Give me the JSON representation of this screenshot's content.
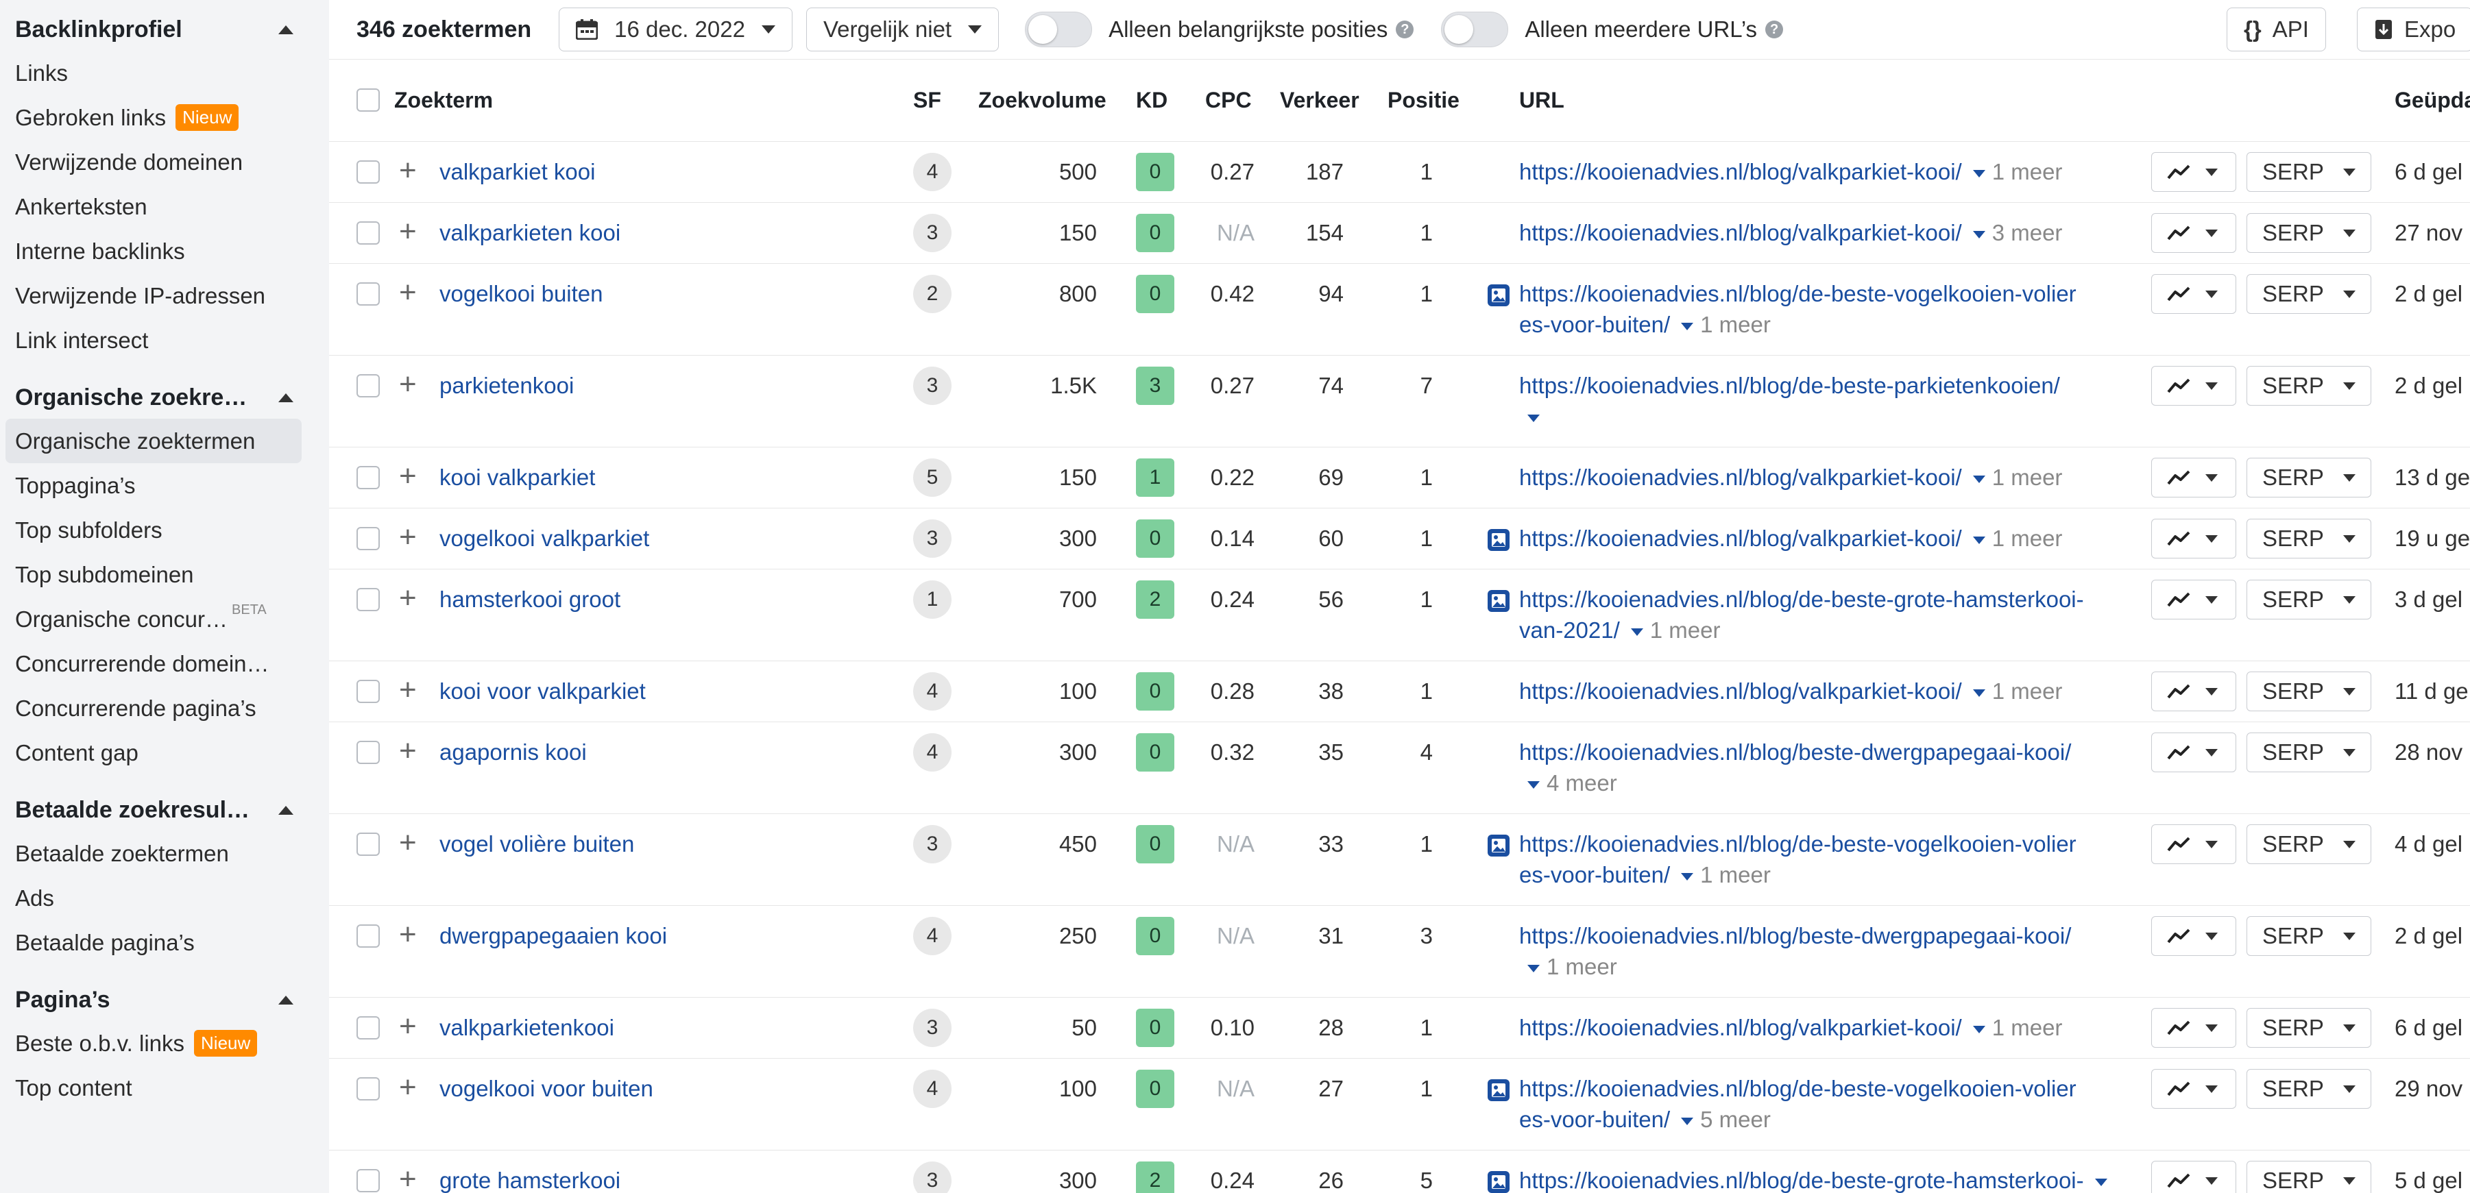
{
  "sidebar": {
    "sections": [
      {
        "title": "Backlinkprofiel",
        "items": [
          {
            "label": "Links"
          },
          {
            "label": "Gebroken links",
            "badge": "Nieuw"
          },
          {
            "label": "Verwijzende domeinen"
          },
          {
            "label": "Ankerteksten"
          },
          {
            "label": "Interne backlinks"
          },
          {
            "label": "Verwijzende IP-adressen"
          },
          {
            "label": "Link intersect"
          }
        ]
      },
      {
        "title": "Organische zoekre…",
        "items": [
          {
            "label": "Organische zoektermen",
            "active": true
          },
          {
            "label": "Toppagina’s"
          },
          {
            "label": "Top subfolders"
          },
          {
            "label": "Top subdomeinen"
          },
          {
            "label": "Organische concur…",
            "beta": "BETA"
          },
          {
            "label": "Concurrerende domein…"
          },
          {
            "label": "Concurrerende pagina’s"
          },
          {
            "label": "Content gap"
          }
        ]
      },
      {
        "title": "Betaalde zoekresul…",
        "items": [
          {
            "label": "Betaalde zoektermen"
          },
          {
            "label": "Ads"
          },
          {
            "label": "Betaalde pagina’s"
          }
        ]
      },
      {
        "title": "Pagina’s",
        "items": [
          {
            "label": "Beste o.b.v. links",
            "badge": "Nieuw"
          },
          {
            "label": "Top content"
          }
        ]
      }
    ]
  },
  "toolbar": {
    "count": "346 zoektermen",
    "date": "16 dec. 2022",
    "compare": "Vergelijk niet",
    "toggle1": "Alleen belangrijkste posities",
    "toggle2": "Alleen meerdere URL’s",
    "api": "API",
    "export": "Expo"
  },
  "table": {
    "headers": {
      "keyword": "Zoekterm",
      "sf": "SF",
      "volume": "Zoekvolume",
      "kd": "KD",
      "cpc": "CPC",
      "traffic": "Verkeer",
      "position": "Positie",
      "url": "URL",
      "updated": "Geüpda"
    },
    "serp_label": "SERP",
    "rows": [
      {
        "keyword": "valkparkiet kooi",
        "sf": "4",
        "volume": "500",
        "kd": "0",
        "cpc": "0.27",
        "traffic": "187",
        "position": "1",
        "url1": "https://kooienadvies.nl/blog/valkparkiet-kooi/",
        "url2": "",
        "more": "1 meer",
        "img": false,
        "updated": "6 d gel",
        "tall": false
      },
      {
        "keyword": "valkparkieten kooi",
        "sf": "3",
        "volume": "150",
        "kd": "0",
        "cpc": "N/A",
        "traffic": "154",
        "position": "1",
        "url1": "https://kooienadvies.nl/blog/valkparkiet-kooi/",
        "url2": "",
        "more": "3 meer",
        "img": false,
        "updated": "27 nov",
        "tall": false
      },
      {
        "keyword": "vogelkooi buiten",
        "sf": "2",
        "volume": "800",
        "kd": "0",
        "cpc": "0.42",
        "traffic": "94",
        "position": "1",
        "url1": "https://kooienadvies.nl/blog/de-beste-vogelkooien-volier",
        "url2": "es-voor-buiten/",
        "more": "1 meer",
        "img": true,
        "updated": "2 d gel",
        "tall": true
      },
      {
        "keyword": "parkietenkooi",
        "sf": "3",
        "volume": "1.5K",
        "kd": "3",
        "cpc": "0.27",
        "traffic": "74",
        "position": "7",
        "url1": "https://kooienadvies.nl/blog/de-beste-parkietenkooien/",
        "url2": "",
        "more": "",
        "img": false,
        "updated": "2 d gel",
        "tall": true
      },
      {
        "keyword": "kooi valkparkiet",
        "sf": "5",
        "volume": "150",
        "kd": "1",
        "cpc": "0.22",
        "traffic": "69",
        "position": "1",
        "url1": "https://kooienadvies.nl/blog/valkparkiet-kooi/",
        "url2": "",
        "more": "1 meer",
        "img": false,
        "updated": "13 d ge",
        "tall": false
      },
      {
        "keyword": "vogelkooi valkparkiet",
        "sf": "3",
        "volume": "300",
        "kd": "0",
        "cpc": "0.14",
        "traffic": "60",
        "position": "1",
        "url1": "https://kooienadvies.nl/blog/valkparkiet-kooi/",
        "url2": "",
        "more": "1 meer",
        "img": true,
        "updated": "19 u ge",
        "tall": false
      },
      {
        "keyword": "hamsterkooi groot",
        "sf": "1",
        "volume": "700",
        "kd": "2",
        "cpc": "0.24",
        "traffic": "56",
        "position": "1",
        "url1": "https://kooienadvies.nl/blog/de-beste-grote-hamsterkooi-",
        "url2": "van-2021/",
        "more": "1 meer",
        "img": true,
        "updated": "3 d gel",
        "tall": true
      },
      {
        "keyword": "kooi voor valkparkiet",
        "sf": "4",
        "volume": "100",
        "kd": "0",
        "cpc": "0.28",
        "traffic": "38",
        "position": "1",
        "url1": "https://kooienadvies.nl/blog/valkparkiet-kooi/",
        "url2": "",
        "more": "1 meer",
        "img": false,
        "updated": "11 d ge",
        "tall": false
      },
      {
        "keyword": "agapornis kooi",
        "sf": "4",
        "volume": "300",
        "kd": "0",
        "cpc": "0.32",
        "traffic": "35",
        "position": "4",
        "url1": "https://kooienadvies.nl/blog/beste-dwergpapegaai-kooi/",
        "url2": "",
        "more": "4 meer",
        "img": false,
        "updated": "28 nov",
        "tall": true
      },
      {
        "keyword": "vogel volière buiten",
        "sf": "3",
        "volume": "450",
        "kd": "0",
        "cpc": "N/A",
        "traffic": "33",
        "position": "1",
        "url1": "https://kooienadvies.nl/blog/de-beste-vogelkooien-volier",
        "url2": "es-voor-buiten/",
        "more": "1 meer",
        "img": true,
        "updated": "4 d gel",
        "tall": true
      },
      {
        "keyword": "dwergpapegaaien kooi",
        "sf": "4",
        "volume": "250",
        "kd": "0",
        "cpc": "N/A",
        "traffic": "31",
        "position": "3",
        "url1": "https://kooienadvies.nl/blog/beste-dwergpapegaai-kooi/",
        "url2": "",
        "more": "1 meer",
        "img": false,
        "updated": "2 d gel",
        "tall": true
      },
      {
        "keyword": "valkparkietenkooi",
        "sf": "3",
        "volume": "50",
        "kd": "0",
        "cpc": "0.10",
        "traffic": "28",
        "position": "1",
        "url1": "https://kooienadvies.nl/blog/valkparkiet-kooi/",
        "url2": "",
        "more": "1 meer",
        "img": false,
        "updated": "6 d gel",
        "tall": false
      },
      {
        "keyword": "vogelkooi voor buiten",
        "sf": "4",
        "volume": "100",
        "kd": "0",
        "cpc": "N/A",
        "traffic": "27",
        "position": "1",
        "url1": "https://kooienadvies.nl/blog/de-beste-vogelkooien-volier",
        "url2": "es-voor-buiten/",
        "more": "5 meer",
        "img": true,
        "updated": "29 nov",
        "tall": true
      },
      {
        "keyword": "grote hamsterkooi",
        "sf": "3",
        "volume": "300",
        "kd": "2",
        "cpc": "0.24",
        "traffic": "26",
        "position": "5",
        "url1": "https://kooienadvies.nl/blog/de-beste-grote-hamsterkooi-",
        "url2": "",
        "more": "",
        "img": true,
        "updated": "5 d gel",
        "tall": false
      }
    ]
  }
}
